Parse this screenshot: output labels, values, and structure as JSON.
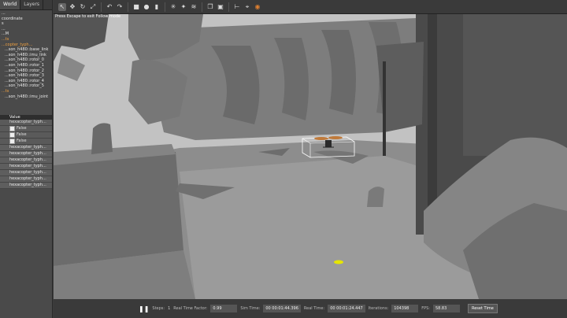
{
  "tabs": [
    "World",
    "Layers"
  ],
  "tree": [
    {
      "label": "...",
      "cls": ""
    },
    {
      "label": "coordinate",
      "cls": ""
    },
    {
      "label": "s",
      "cls": ""
    },
    {
      "label": "...",
      "cls": ""
    },
    {
      "label": "...M",
      "cls": ""
    },
    {
      "label": "...ts",
      "cls": "orange"
    },
    {
      "label": "...copter_typh...",
      "cls": "orange"
    },
    {
      "label": "...son_h480::base_link",
      "cls": "sub"
    },
    {
      "label": "...son_h480::imu_link",
      "cls": "sub"
    },
    {
      "label": "...son_h480::rotor_0",
      "cls": "sub"
    },
    {
      "label": "...son_h480::rotor_1",
      "cls": "sub"
    },
    {
      "label": "...son_h480::rotor_2",
      "cls": "sub"
    },
    {
      "label": "...son_h480::rotor_3",
      "cls": "sub"
    },
    {
      "label": "...son_h480::rotor_4",
      "cls": "sub"
    },
    {
      "label": "...son_h480::rotor_5",
      "cls": "sub"
    },
    {
      "label": "...ts",
      "cls": "orange"
    },
    {
      "label": "...son_h480::imu_joint",
      "cls": "sub"
    }
  ],
  "props": {
    "value_header": "Value",
    "rows": [
      {
        "key": "",
        "value": "hexacopter_typh..."
      },
      {
        "key": "",
        "value": "False"
      },
      {
        "key": "",
        "value": "False"
      },
      {
        "key": "",
        "value": "False"
      }
    ]
  },
  "list": [
    "hexacopter_typh...",
    "hexacopter_typh...",
    "hexacopter_typh...",
    "hexacopter_typh...",
    "hexacopter_typh...",
    "hexacopter_typh...",
    "hexacopter_typh..."
  ],
  "toolbar": {
    "icons": [
      "select-icon",
      "translate-icon",
      "rotate-icon",
      "scale-icon",
      "undo-icon",
      "redo-icon",
      "box-icon",
      "sphere-icon",
      "cylinder-icon",
      "sun-icon",
      "spot-light-icon",
      "directional-light-icon",
      "copy-icon",
      "paste-icon",
      "align-icon",
      "snap-icon",
      "screenshot-icon"
    ]
  },
  "viewport": {
    "hint": "Press Escape to exit Follow mode"
  },
  "bottom": {
    "steps_label": "Steps:",
    "steps_value": "1",
    "rtf_label": "Real Time Factor:",
    "rtf_value": "0.99",
    "sim_label": "Sim Time:",
    "sim_value": "00 00:01:44.396",
    "real_label": "Real Time:",
    "real_value": "00 00:01:24.447",
    "iter_label": "Iterations:",
    "iter_value": "104398",
    "fps_label": "FPS:",
    "fps_value": "58.83",
    "reset_label": "Reset Time"
  }
}
